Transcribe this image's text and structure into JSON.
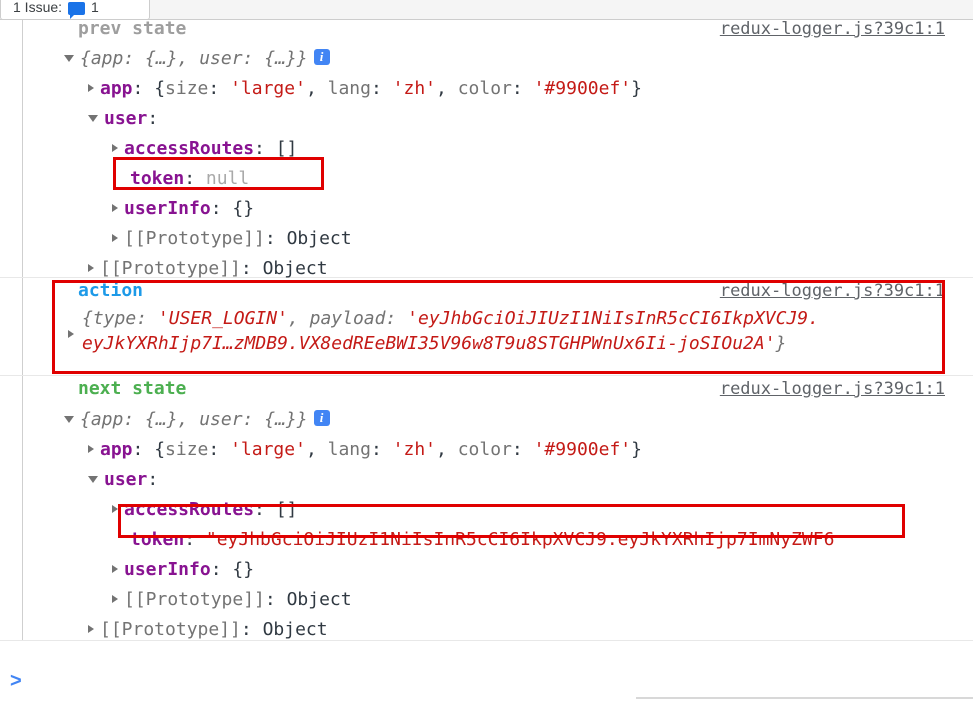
{
  "issues_tab": {
    "label_prefix": "1 Issue:",
    "icon": "message-icon",
    "count": "1"
  },
  "console": {
    "prompt_symbol": ">",
    "source_link": "redux-logger.js?39c1:1",
    "groups": [
      {
        "id": "prev-state",
        "title": "prev state",
        "title_color": "#9e9e9e",
        "summary": "{app: {…}, user: {…}}",
        "info_badge": "i",
        "rows": [
          {
            "name": "app",
            "text": "app",
            "value_parts": [
              {
                "t": ": {",
                "c": "punct"
              },
              {
                "t": "size",
                "c": "prop"
              },
              {
                "t": ": ",
                "c": "punct"
              },
              {
                "t": "'large'",
                "c": "str"
              },
              {
                "t": ", ",
                "c": "punct"
              },
              {
                "t": "lang",
                "c": "prop"
              },
              {
                "t": ": ",
                "c": "punct"
              },
              {
                "t": "'zh'",
                "c": "str"
              },
              {
                "t": ", ",
                "c": "punct"
              },
              {
                "t": "color",
                "c": "prop"
              },
              {
                "t": ": ",
                "c": "punct"
              },
              {
                "t": "'#9900ef'",
                "c": "str"
              },
              {
                "t": "}",
                "c": "punct"
              }
            ]
          },
          {
            "name": "user",
            "text": "user",
            "value": ":"
          },
          {
            "name": "accessRoutes",
            "text": "accessRoutes",
            "value": ": []"
          },
          {
            "name": "token",
            "text": "token",
            "value": ": ",
            "null_value": "null"
          },
          {
            "name": "userInfo",
            "text": "userInfo",
            "value": ": {}"
          },
          {
            "name": "prototype-inner",
            "text": "[[Prototype]]",
            "value": ": Object"
          },
          {
            "name": "prototype-outer",
            "text": "[[Prototype]]",
            "value": ": Object"
          }
        ]
      },
      {
        "id": "action",
        "title": "action",
        "title_color": "#1d9ae8",
        "line1_open": "{",
        "line1_key": "type",
        "line1_colon": ": ",
        "line1_value": "'USER_LOGIN'",
        "line1_sep": ", ",
        "line2_key": "payload",
        "line2_colon": ": ",
        "payload_line1": "'eyJhbGciOiJIUzI1NiIsInR5cCI6IkpXVCJ9.",
        "payload_line2": "eyJkYXRhIjp7I…zMDB9.VX8edREeBWI35V96w8T9u8STGHPWnUx6Ii-joSIOu2A'",
        "close": "}"
      },
      {
        "id": "next-state",
        "title": "next state",
        "title_color": "#4caf50",
        "summary": "{app: {…}, user: {…}}",
        "info_badge": "i",
        "rows": [
          {
            "name": "app",
            "text": "app",
            "value_parts": [
              {
                "t": ": {",
                "c": "punct"
              },
              {
                "t": "size",
                "c": "prop"
              },
              {
                "t": ": ",
                "c": "punct"
              },
              {
                "t": "'large'",
                "c": "str"
              },
              {
                "t": ", ",
                "c": "punct"
              },
              {
                "t": "lang",
                "c": "prop"
              },
              {
                "t": ": ",
                "c": "punct"
              },
              {
                "t": "'zh'",
                "c": "str"
              },
              {
                "t": ", ",
                "c": "punct"
              },
              {
                "t": "color",
                "c": "prop"
              },
              {
                "t": ": ",
                "c": "punct"
              },
              {
                "t": "'#9900ef'",
                "c": "str"
              },
              {
                "t": "}",
                "c": "punct"
              }
            ]
          },
          {
            "name": "user",
            "text": "user",
            "value": ":"
          },
          {
            "name": "accessRoutes",
            "text": "accessRoutes",
            "value": ": []"
          },
          {
            "name": "token",
            "text": "token",
            "value": ": ",
            "str_value": "\"eyJhbGciOiJIUzI1NiIsInR5cCI6IkpXVCJ9.eyJkYXRhIjp7ImNyZWF6"
          },
          {
            "name": "userInfo",
            "text": "userInfo",
            "value": ": {}"
          },
          {
            "name": "prototype-inner",
            "text": "[[Prototype]]",
            "value": ": Object"
          },
          {
            "name": "prototype-outer",
            "text": "[[Prototype]]",
            "value": ": Object"
          }
        ]
      }
    ]
  },
  "annotations": [
    {
      "name": "token-null-highlight",
      "color": "#e00000"
    },
    {
      "name": "action-block-highlight",
      "color": "#e00000"
    },
    {
      "name": "token-value-highlight",
      "color": "#e00000"
    }
  ]
}
